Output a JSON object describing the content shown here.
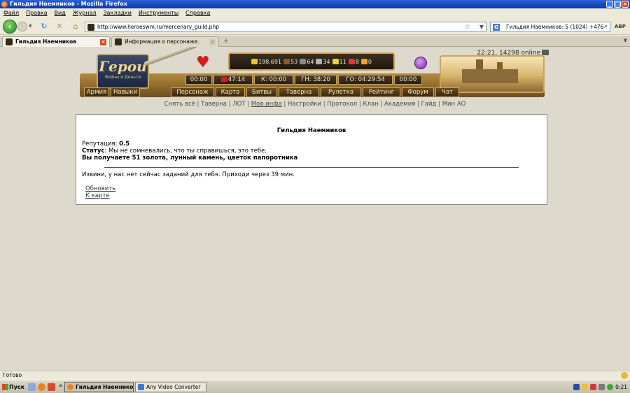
{
  "window": {
    "title": "Гильдия Наемников - Mozilla Firefox",
    "controls": [
      "_",
      "□",
      "×"
    ]
  },
  "menu": [
    "Файл",
    "Правка",
    "Вид",
    "Журнал",
    "Закладки",
    "Инструменты",
    "Справка"
  ],
  "toolbar": {
    "url": "http://www.heroeswm.ru/mercenary_guild.php",
    "search_text": "Гильдия Наемников: 5 (1024) +476",
    "search_engine": "G",
    "addon": "ABP"
  },
  "tabs": [
    {
      "label": "Гильдия Наемников",
      "active": true
    },
    {
      "label": "Информация о персонаже.",
      "active": false
    }
  ],
  "game": {
    "time_online": "22:21, 14298 online",
    "logo_title": "Герои",
    "logo_subtitle": "Войны и Деньги",
    "resources": [
      {
        "icon": "gold-icon",
        "value": "198,691",
        "color": "#e8c33a"
      },
      {
        "icon": "wood-icon",
        "value": "53",
        "color": "#8a5a2a"
      },
      {
        "icon": "ore-icon",
        "value": "64",
        "color": "#8a8a8a"
      },
      {
        "icon": "mercury-icon",
        "value": "34",
        "color": "#b0b0b0"
      },
      {
        "icon": "sulfur-icon",
        "value": "11",
        "color": "#e8d23a"
      },
      {
        "icon": "crystal-icon",
        "value": "8",
        "color": "#d83a3a"
      },
      {
        "icon": "gems-icon",
        "value": "0",
        "color": "#e8a33a"
      }
    ],
    "timers": [
      {
        "label": "00:00",
        "icon": false
      },
      {
        "label": "47:14",
        "icon": true
      },
      {
        "label": "К: 00:00",
        "icon": false
      },
      {
        "label": "ГН: 38:20",
        "icon": false
      },
      {
        "label": "ГО: 04:29:54",
        "icon": false
      },
      {
        "label": "00:00",
        "icon": false
      }
    ],
    "nav": [
      "Армия",
      "Навыки",
      "Персонаж",
      "Карта",
      "Битвы",
      "Таверна",
      "Рулетка",
      "Рейтинг",
      "Форум",
      "Чат"
    ],
    "links": [
      "Снять всё",
      "Таверна",
      "ЛОТ",
      "Моя инфа",
      "Настройки",
      "Протокол",
      "Клан",
      "Академия",
      "Гайд",
      "Мин АО"
    ],
    "links_active": "Моя инфа"
  },
  "content": {
    "title": "Гильдия Наемников",
    "reputation_label": "Репутация:",
    "reputation_value": "0.5",
    "status_label": "Статус",
    "status_text": ": Мы не сомневались, что ты справишься, это тебе.",
    "reward": "Вы получаете 51 золота, лунный камень, цветок папоротника",
    "no_tasks": "Извини, у нас нет сейчас заданий для тебя. Приходи через 39 мин.",
    "refresh": "Обновить",
    "to_map": "К карте"
  },
  "statusbar": {
    "text": "Готово"
  },
  "taskbar": {
    "start": "Пуск",
    "chevron": "»",
    "tasks": [
      {
        "label": "Гильдия Наемников -...",
        "active": true
      },
      {
        "label": "Any Video Converter",
        "active": false
      }
    ],
    "clock": "0:21"
  }
}
